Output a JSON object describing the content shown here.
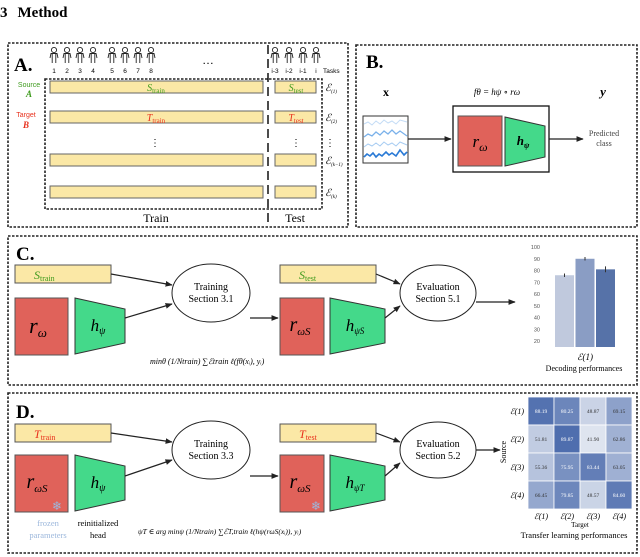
{
  "section": {
    "number": "3",
    "title": "Method"
  },
  "colors": {
    "source": "#3d9a1c",
    "target": "#e8301c",
    "data_bar": "#fbe8a6",
    "encoder": "#e0625a",
    "head": "#44d98a",
    "frozen": "#9db8dc",
    "signal": "#4a90e2"
  },
  "panel_a": {
    "label": "A.",
    "subjects_train": [
      "1",
      "2",
      "3",
      "4",
      "5",
      "6",
      "7",
      "8"
    ],
    "ellipsis": "…",
    "subjects_test": [
      "i-3",
      "i-2",
      "i-1",
      "i"
    ],
    "tasks_label": "Tasks",
    "source": {
      "line1": "Source",
      "line2": "A"
    },
    "target": {
      "line1": "Target",
      "line2": "B"
    },
    "s_train": {
      "main": "S",
      "sub": "train"
    },
    "s_test": {
      "main": "S",
      "sub": "test"
    },
    "t_train": {
      "main": "T",
      "sub": "train"
    },
    "t_test": {
      "main": "T",
      "sub": "test"
    },
    "vdots": "⋮",
    "task_labels": [
      {
        "main": "ℰ",
        "sub": "(1)"
      },
      {
        "main": "ℰ",
        "sub": "(2)"
      },
      {
        "main": "ℰ",
        "sub": "(k−1)"
      },
      {
        "main": "ℰ",
        "sub": "(k)"
      }
    ],
    "train_label": "Train",
    "test_label": "Test"
  },
  "panel_b": {
    "label": "B.",
    "input": "x",
    "model": "fθ = hψ ∘ rω",
    "output": "y",
    "encoder": {
      "main": "r",
      "sub": "ω"
    },
    "head": {
      "main": "h",
      "sub": "ψ"
    },
    "predicted": {
      "line1": "Predicted",
      "line2": "class"
    }
  },
  "panel_c": {
    "label": "C.",
    "train_data": {
      "main": "S",
      "sub": "train"
    },
    "test_data": {
      "main": "S",
      "sub": "test"
    },
    "encoder": {
      "main": "r",
      "sub": "ω"
    },
    "head": {
      "main": "h",
      "sub": "ψ"
    },
    "encoder_s": {
      "main": "r",
      "sub": "ωS"
    },
    "head_s": {
      "main": "h",
      "sub": "ψS"
    },
    "training": {
      "line1": "Training",
      "line2": "Section 3.1"
    },
    "evaluation": {
      "line1": "Evaluation",
      "line2": "Section 5.1"
    },
    "formula": "minθ (1/Ntrain) ∑ℰtrain ℓ(fθ(xᵢ), yᵢ)",
    "chart_caption": "Decoding performances"
  },
  "panel_d": {
    "label": "D.",
    "train_data": {
      "main": "T",
      "sub": "train"
    },
    "test_data": {
      "main": "T",
      "sub": "test"
    },
    "encoder_s": {
      "main": "r",
      "sub": "ωS"
    },
    "head": {
      "main": "h",
      "sub": "ψ"
    },
    "head_t": {
      "main": "h",
      "sub": "ψT"
    },
    "training": {
      "line1": "Training",
      "line2": "Section 3.3"
    },
    "evaluation": {
      "line1": "Evaluation",
      "line2": "Section 5.2"
    },
    "frozen": {
      "line1": "frozen",
      "line2": "parameters"
    },
    "reinit": {
      "line1": "reinitialized",
      "line2": "head"
    },
    "formula": "ψT ∈ arg minψ (1/Ntrain) ∑ℰT,train ℓ(hψ(rωS(xᵢ)), yᵢ)",
    "snowflake_icon": "snowflake"
  },
  "chart_data": [
    {
      "type": "bar",
      "categories": [
        "ℰ(1)"
      ],
      "series": [
        {
          "values": [
            76
          ],
          "error": [
            1.5
          ],
          "color": "#c0c9dd"
        },
        {
          "values": [
            90
          ],
          "error": [
            1.5
          ],
          "color": "#8a9dc4"
        },
        {
          "values": [
            81
          ],
          "error": [
            2.5
          ],
          "color": "#5672a8"
        }
      ],
      "yticks": [
        "20",
        "30",
        "40",
        "50",
        "60",
        "70",
        "80",
        "90",
        "100"
      ],
      "ylim": [
        15,
        100
      ],
      "xlabel": "ℰ(1)",
      "title": "Decoding performances",
      "grid": false
    },
    {
      "type": "heatmap",
      "rows": [
        "ℰ(1)",
        "ℰ(2)",
        "ℰ(3)",
        "ℰ(4)"
      ],
      "cols": [
        "ℰ(1)",
        "ℰ(2)",
        "ℰ(3)",
        "ℰ(4)"
      ],
      "ylabel": "Source",
      "xlabel": "Target",
      "title": "Transfer learning performances",
      "values": [
        [
          "88.19",
          "80.25",
          "48.87",
          "69.15"
        ],
        [
          "51.81",
          "89.87",
          "41.90",
          "62.86"
        ],
        [
          "55.36",
          "75.95",
          "83.44",
          "63.05"
        ],
        [
          "66.45",
          "79.85",
          "48.57",
          "84.60"
        ]
      ]
    }
  ]
}
